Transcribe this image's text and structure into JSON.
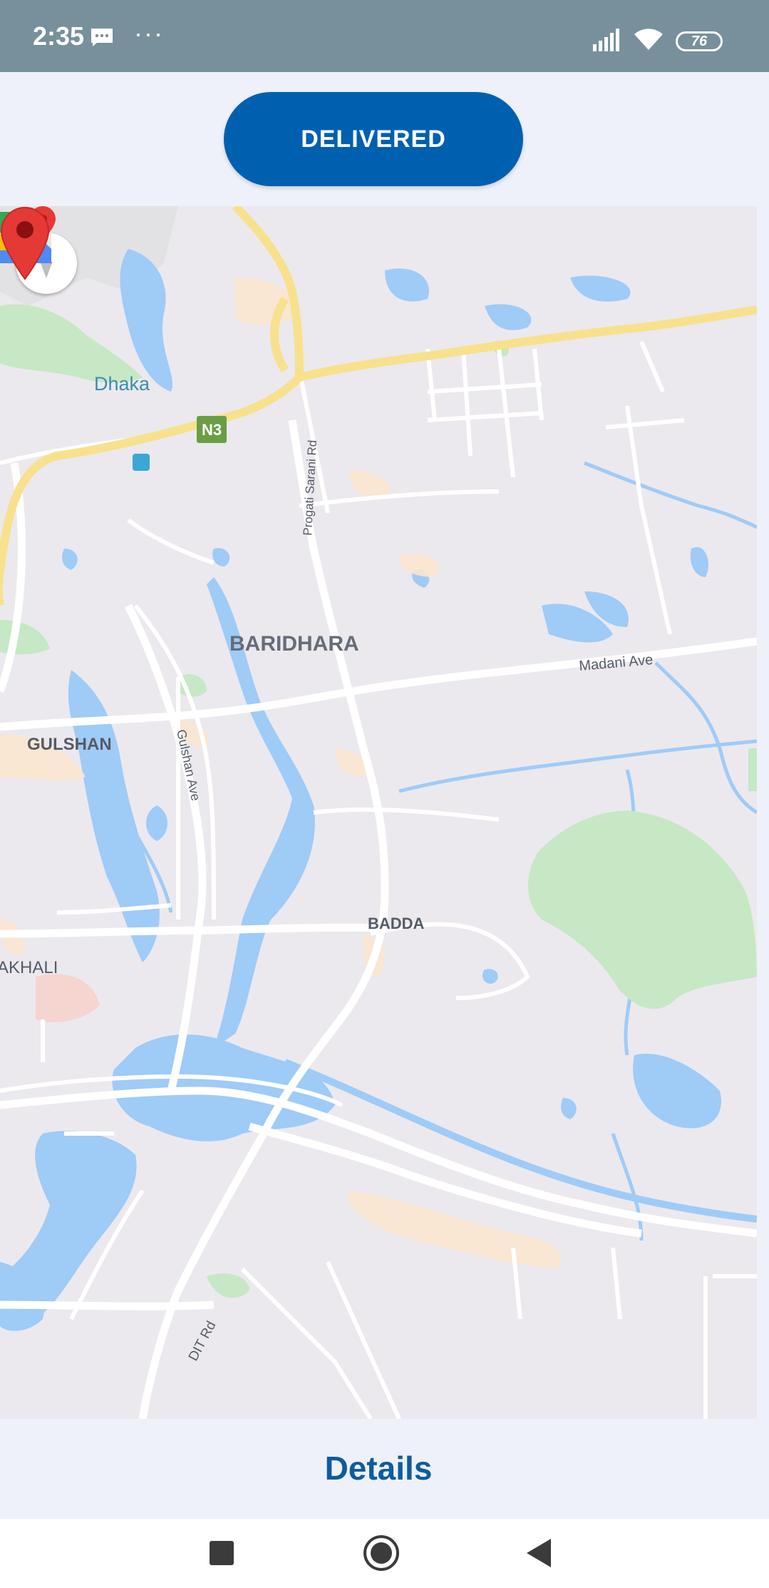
{
  "status_bar": {
    "time": "2:35",
    "battery": "76",
    "icons": [
      "message-icon",
      "more-dots-icon",
      "signal-icon",
      "wifi-icon",
      "battery-icon"
    ],
    "more": "···"
  },
  "order": {
    "status_label": "DELIVERED",
    "status_color": "#0060b0"
  },
  "map": {
    "labels": {
      "dhaka": "Dhaka",
      "n3": "N3",
      "baridhara": "BARIDHARA",
      "gulshan": "GULSHAN",
      "gulshan_ave": "Gulshan Ave",
      "progati_sarani": "Progati Sarani Rd",
      "madani_ave": "Madani Ave",
      "badda": "BADDA",
      "khali": "AKHALI",
      "dit_rd": "DIT Rd"
    },
    "colors": {
      "land": "#ebe9ee",
      "water": "#9fcbf7",
      "park": "#c6e8c4",
      "road": "#ffffff",
      "highway": "#f8e18c",
      "pin": "#e53935"
    },
    "icons": [
      "compass-icon",
      "google-maps-icon",
      "location-pin-icon"
    ]
  },
  "footer": {
    "details_label": "Details"
  },
  "nav": {
    "icons": [
      "recents-square-icon",
      "home-circle-icon",
      "back-triangle-icon"
    ]
  }
}
